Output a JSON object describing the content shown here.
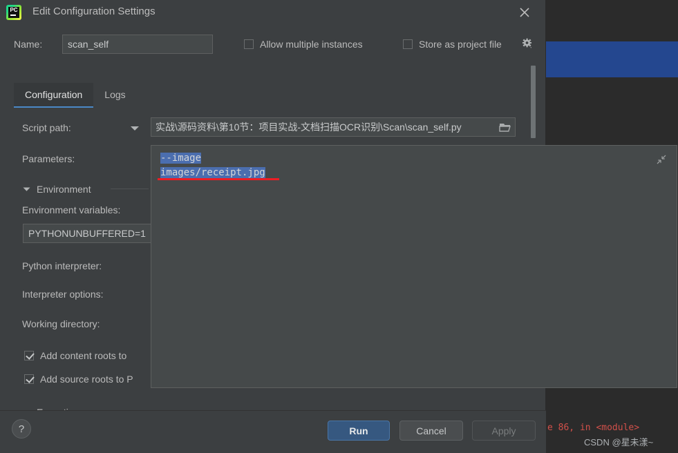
{
  "window": {
    "title": "Edit Configuration Settings",
    "logo_icon": "pycharm-logo-icon",
    "logo_text": "PC",
    "close_icon": "close-icon"
  },
  "name_row": {
    "label": "Name:",
    "value": "scan_self",
    "allow_multiple_label": "Allow multiple instances",
    "allow_multiple_checked": false,
    "store_as_project_label": "Store as project file",
    "store_as_project_checked": false,
    "gear_icon": "gear-icon"
  },
  "tabs": [
    {
      "label": "Configuration",
      "active": true
    },
    {
      "label": "Logs",
      "active": false
    }
  ],
  "form": {
    "script_path_label": "Script path:",
    "script_path_dropdown_icon": "chevron-down-icon",
    "script_path_value": "实战\\源码资料\\第10节：项目实战-文档扫描OCR识别\\Scan\\scan_self.py",
    "browse_icon": "folder-icon",
    "parameters_label": "Parameters:",
    "environment_section_label": "Environment",
    "environment_caret_icon": "caret-down-icon",
    "environment_variables_label": "Environment variables:",
    "environment_variables_value": "PYTHONUNBUFFERED=1",
    "python_interpreter_label": "Python interpreter:",
    "interpreter_options_label": "Interpreter options:",
    "working_directory_label": "Working directory:",
    "add_content_roots_label": "Add content roots to",
    "add_content_roots_checked": true,
    "add_source_roots_label": "Add source roots to P",
    "add_source_roots_checked": true,
    "execution_section_label": "Execution",
    "execution_caret_icon": "caret-down-icon"
  },
  "parameters_panel": {
    "line1": "--image",
    "line2": "images/receipt.jpg",
    "selected": true,
    "shrink_icon": "collapse-diagonal-icon",
    "annotation_color": "#ee1d24"
  },
  "footer": {
    "help_icon": "question-mark-icon",
    "help_label": "?",
    "run_label": "Run",
    "cancel_label": "Cancel",
    "apply_label": "Apply",
    "apply_disabled": true
  },
  "background": {
    "error_text": "e 86, in <module>",
    "error_color": "#d2504a",
    "watermark": "CSDN @星未漾~",
    "selection_color": "#24478f"
  }
}
